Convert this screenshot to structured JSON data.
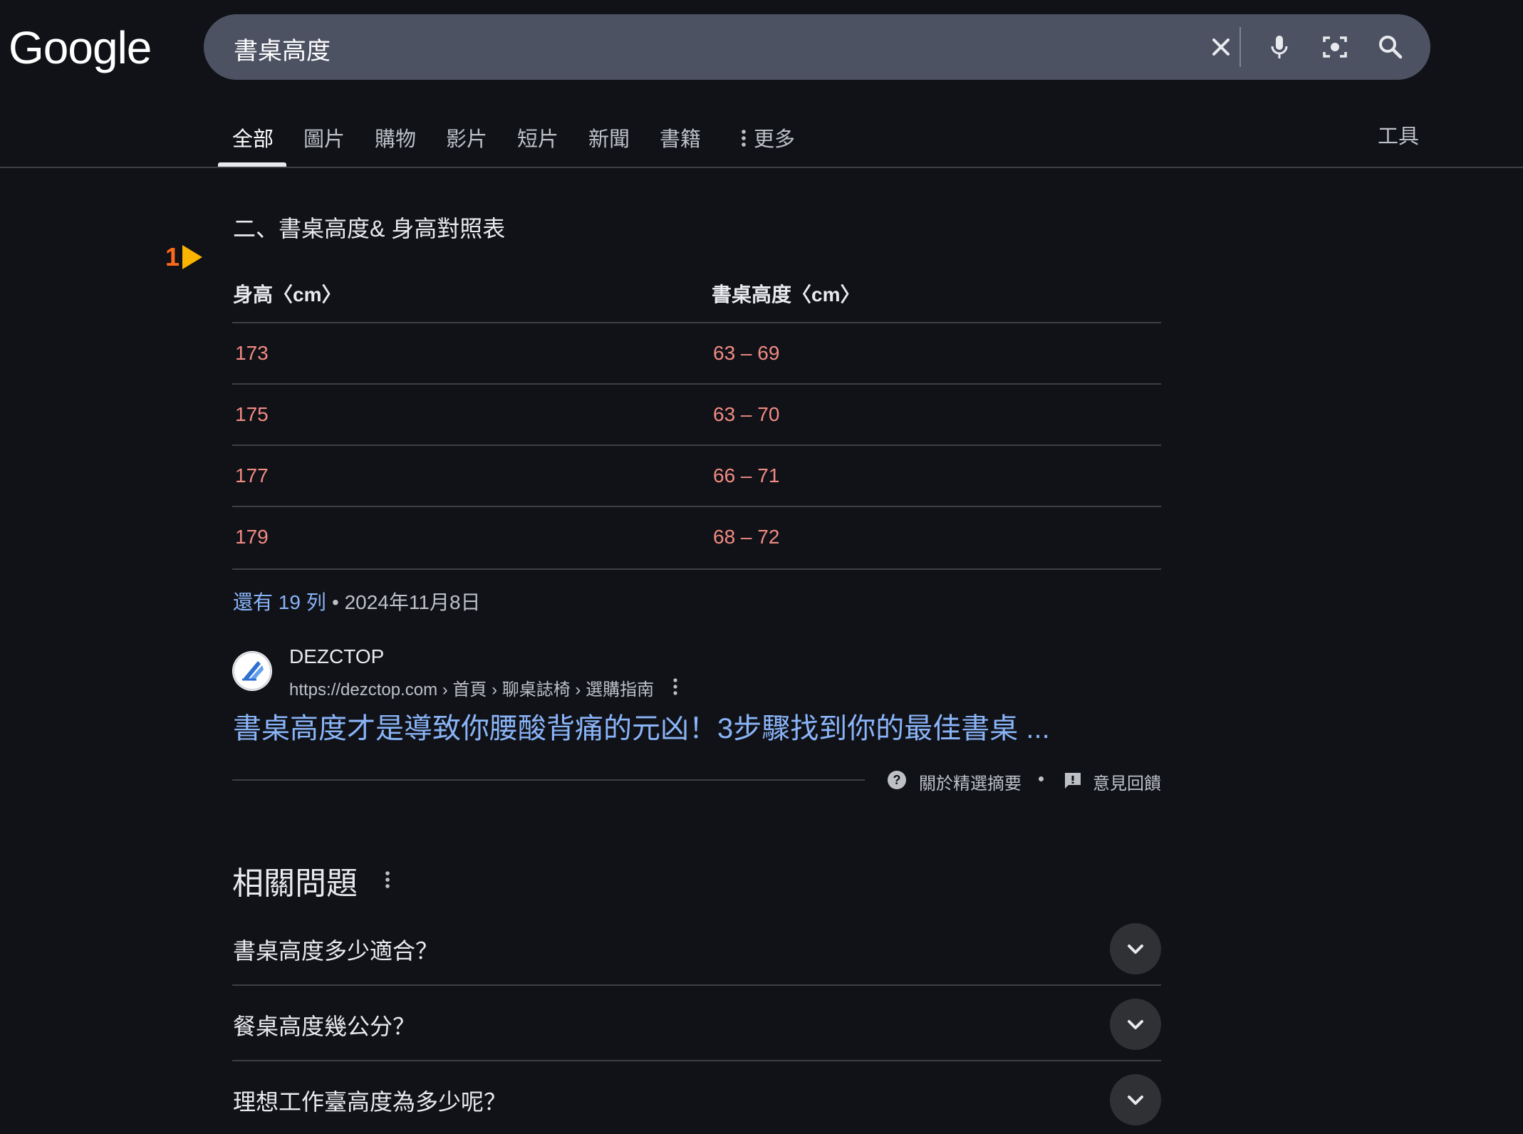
{
  "logo": {
    "text": "Google"
  },
  "search": {
    "query": "書桌高度"
  },
  "tabs": [
    {
      "label": "全部"
    },
    {
      "label": "圖片"
    },
    {
      "label": "購物"
    },
    {
      "label": "影片"
    },
    {
      "label": "短片"
    },
    {
      "label": "新聞"
    },
    {
      "label": "書籍"
    },
    {
      "label": "更多"
    }
  ],
  "tools_label": "工具",
  "marker": {
    "number": "1"
  },
  "snippet": {
    "title": "二、書桌高度& 身高對照表",
    "headers": [
      "身高〈cm〉",
      "書桌高度〈cm〉"
    ],
    "rows": [
      [
        "173",
        "63 – 69"
      ],
      [
        "175",
        "63 – 70"
      ],
      [
        "177",
        "66 – 71"
      ],
      [
        "179",
        "68 – 72"
      ]
    ],
    "more_rows": "還有 19 列",
    "date": "• 2024年11月8日"
  },
  "result": {
    "site_name": "DEZCTOP",
    "url": "https://dezctop.com › 首頁 › 聊桌誌椅 › 選購指南",
    "title": "書桌高度才是導致你腰酸背痛的元凶！3步驟找到你的最佳書桌 ...",
    "about": "關於精選摘要",
    "feedback": "意見回饋"
  },
  "paa": {
    "title": "相關問題",
    "questions": [
      "書桌高度多少適合？",
      "餐桌高度幾公分？",
      "理想工作臺高度為多少呢？"
    ]
  },
  "colors": {
    "background": "#101218",
    "searchbar": "#4d5263",
    "link": "#8ab4f8",
    "table_value": "#f28b82",
    "marker": "#ff6a1a",
    "marker_triangle": "#fbb400"
  }
}
